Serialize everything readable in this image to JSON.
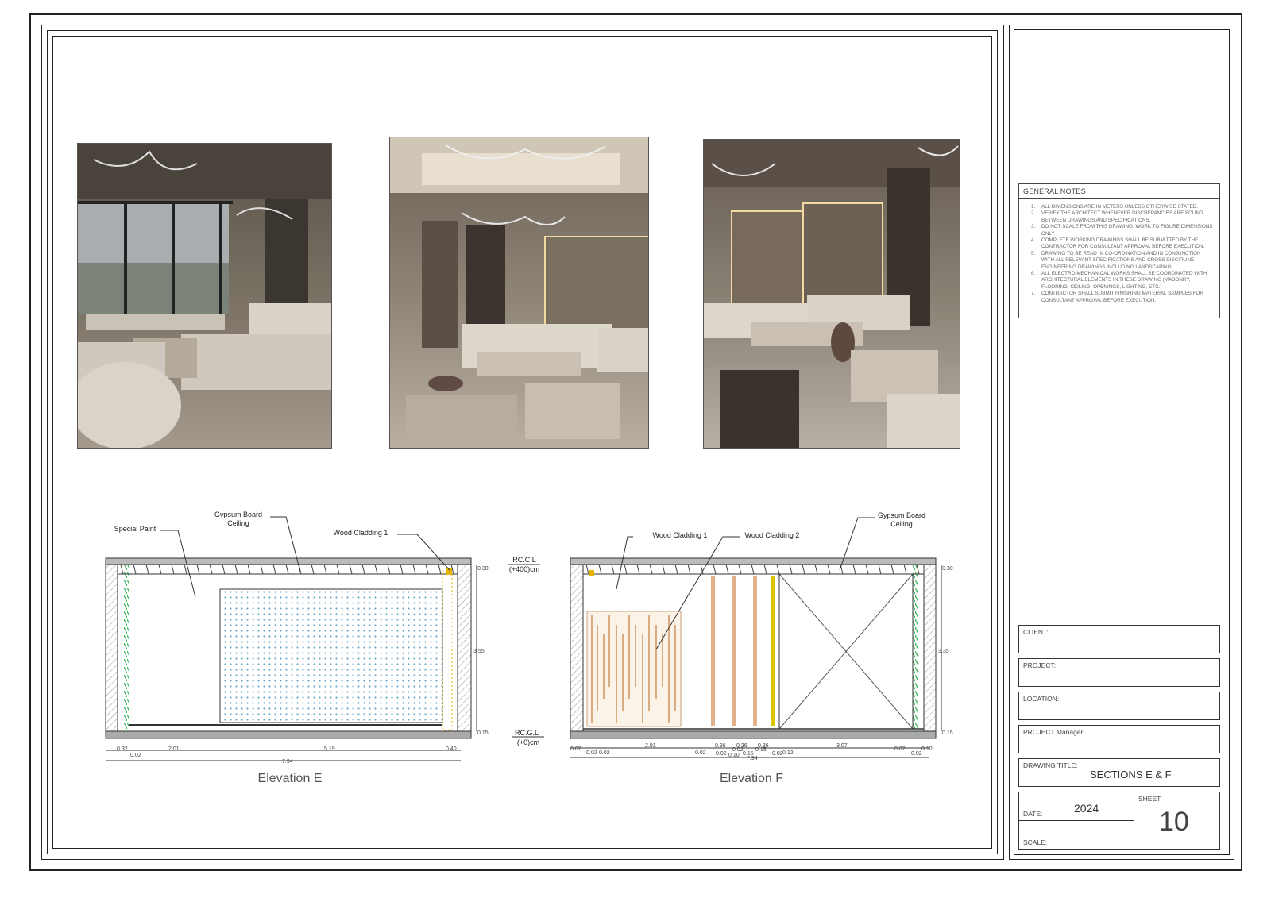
{
  "renders": [
    {
      "name": "render-1"
    },
    {
      "name": "render-2"
    },
    {
      "name": "render-3"
    }
  ],
  "general_notes": {
    "title": "GENERAL NOTES",
    "items": [
      "ALL DIMENSIONS ARE IN METERS UNLESS OTHERWISE STATED.",
      "VERIFY THE ARCHITECT WHENEVER DISCREPANCIES ARE FOUND BETWEEN DRAWINGS AND SPECIFICATIONS.",
      "DO NOT SCALE FROM THIS DRAWING. WORK TO FIGURE DIMENSIONS ONLY.",
      "COMPLETE WORKING DRAWINGS SHALL BE SUBMITTED BY THE CONTRACTOR FOR CONSULTANT APPROVAL BEFORE EXECUTION.",
      "DRAWING TO BE READ IN CO-ORDINATION AND IN CONJUNCTION WITH ALL RELEVANT SPECIFICATIONS AND CROSS DISCIPLINE ENGINEERING DRAWINGS INCLUDING LANDSCAPING.",
      "ALL ELECTRO-MECHANICAL WORKS SHALL BE COORDINATED WITH ARCHITECTURAL ELEMENTS IN THESE DRAWING (MASONRY, FLOORING, CEILING, OPENINGS, LIGHTING, ETC.)",
      "CONTRACTOR SHALL SUBMIT FINISHING MATERIAL SAMPLES FOR CONSULTANT APPROVAL BEFORE EXECUTION."
    ]
  },
  "title_block": {
    "client_label": "CLIENT:",
    "project_label": "PROJECT:",
    "location_label": "LOCATION:",
    "manager_label": "PROJECT Manager:",
    "drawing_title_label": "DRAWING TITLE:",
    "drawing_title": "SECTIONS  E & F",
    "date_label": "DATE:",
    "date_value": "2024",
    "scale_label": "SCALE:",
    "scale_value": "-",
    "sheet_label": "SHEET",
    "sheet_value": "10"
  },
  "elevation_e": {
    "title": "Elevation E",
    "labels": {
      "gypsum": [
        "Gypsum Board",
        "Ceiling"
      ],
      "special_paint": "Special Paint",
      "wood_cladding_1": "Wood Cladding 1"
    },
    "levels": {
      "rccl": "RC.C.L",
      "rccl_val": "(+400)cm",
      "rcgl": "RC.G.L",
      "rcgl_val": "(+0)cm"
    },
    "dims": {
      "top": "0.30",
      "height": "3.55",
      "bottom": "0.15",
      "d1": "0.32",
      "d2": "2.01",
      "d3": "5.19",
      "d4": "0.40",
      "d5": "0.02",
      "total": "7.94"
    }
  },
  "elevation_f": {
    "title": "Elevation F",
    "labels": {
      "wood_cladding_1": "Wood Cladding 1",
      "wood_cladding_2": "Wood Cladding 2",
      "gypsum": [
        "Gypsum Board",
        "Ceiling"
      ]
    },
    "dims": {
      "top": "0.30",
      "height": "3.35",
      "bottom": "0.15",
      "a": "0.02",
      "b": "0.02",
      "c": "0.02",
      "d": "2.91",
      "e": "0.02",
      "f": "0.36",
      "g": "0.02",
      "h": "0.36",
      "i": "0.10",
      "j": "0.36",
      "k": "0.02",
      "l": "0.12",
      "m": "3.07",
      "n": "0.02",
      "o": "0.10",
      "p": "0.02",
      "q": "0.15",
      "r": "0.15",
      "s": "0.02",
      "total": "7.94"
    }
  }
}
